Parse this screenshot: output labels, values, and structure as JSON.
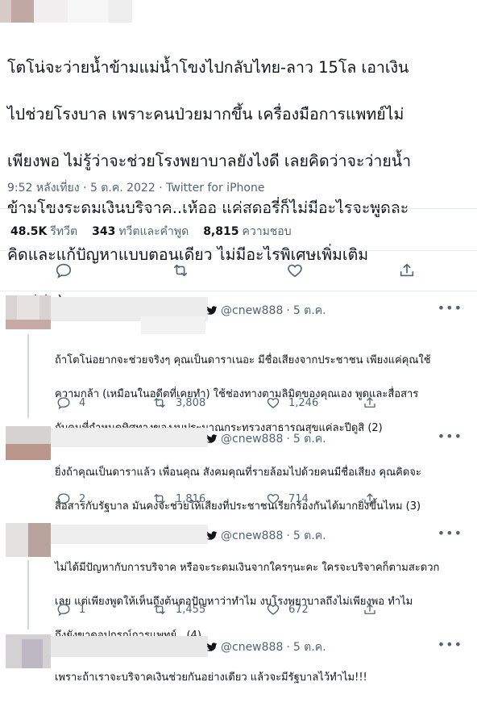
{
  "tweet": {
    "text": "โตโน่จะว่ายน้ำข้ามแม่น้ำโขงไปกลับไทย-ลาว 15โล เอาเงินไปช่วยโรงบาล เพราะคนป่วยมากขึ้น เครื่องมือการแพทย์ไม่เพียงพอ ไม่รู้ว่าจะช่วยโรงพยาบาลยังไงดี เลยคิดว่าจะว่ายน้ำข้ามโขงระดมเงินบริจาค..เห้ออ แค่สดอรี่ก็ไม่มีอะไรจะพูดละ คิดและแก้ปัญหาแบบตอนเดียว ไม่มีอะไรพิเศษเพิ่มเติมเลย(ต่อ)",
    "text_lines": [
      "โตโน่จะว่ายน้ำข้ามแม่น้ำโขงไปกลับไทย-ลาว 15โล เอาเงิน",
      "ไปช่วยโรงบาล เพราะคนป่วยมากขึ้น เครื่องมือการแพทย์ไม่",
      "เพียงพอ ไม่รู้ว่าจะช่วยโรงพยาบาลยังไงดี เลยคิดว่าจะว่ายน้ำ",
      "ข้ามโขงระดมเงินบริจาค..เห้ออ แค่สดอรี่ก็ไม่มีอะไรจะพูดละ",
      "คิดและแก้ปัญหาแบบตอนเดียว ไม่มีอะไรพิเศษเพิ่มเติม",
      "เลย(ต่อ)"
    ],
    "time": "9:52 หลังเที่ยง",
    "date": "5 ต.ค. 2022",
    "source": "Twitter for iPhone",
    "retweets_count": "48.5K",
    "retweets_label": "รีทวีต",
    "quotes_count": "343",
    "quotes_label": "ทวีตและคำพูด",
    "likes_count": "8,815",
    "likes_label": "ความชอบ"
  },
  "replies": [
    {
      "handle": "@cnew888",
      "date": "5 ต.ค.",
      "text_lines": [
        "ถ้าโตโน่อยากจะช่วยจริงๆ คุณเป็นดาราเนอะ มีชื่อเสียงจากประชาชน เพียงแค่คุณใช้",
        "ความกล้า (เหมือนในอดีตที่เคยทำ) ใช้ช่องทางตามลิมิตของคุณเอง พูดและสื่อสาร",
        "กับคนที่กำหนดทิศทางของงบประมาณกระทรวงสาธารณสุขแค่ละปีดูสิ (2)"
      ],
      "replies": "4",
      "retweets": "3,808",
      "likes": "1,246"
    },
    {
      "handle": "@cnew888",
      "date": "5 ต.ค.",
      "text_lines": [
        "ยิ่งถ้าคุณเป็นดาราแล้ว เพื่อนคุณ สังคมคุณที่รายล้อมไปด้วยคนมีชื่อเสียง คุณคิดจะ",
        "สื่อสารกับรัฐบาล มันคงจะช่วยให้เสียงที่ประชาชนเรียกร้องกันได้มากยิ่งขึ้นไหม (3)"
      ],
      "replies": "2",
      "retweets": "1,816",
      "likes": "714"
    },
    {
      "handle": "@cnew888",
      "date": "5 ต.ค.",
      "text_lines": [
        "ไม่ได้มีปัญหากับการบริจาค หรือจะระดมเงินจากใครๆนะคะ ใครจะบริจาคก็ตามสะดวก",
        "เลย แต่เพียงพูดให้เห็นถึงต้นตอปัญหาว่าทำไม งบโรงพยาบาลถึงไม่เพียงพอ ทำไม",
        "ถึงยังขาดอุปกรณ์การแพทย์.. (4)"
      ],
      "replies": "1",
      "retweets": "1,455",
      "likes": "672"
    },
    {
      "handle": "@cnew888",
      "date": "5 ต.ค.",
      "text_lines": [
        "เพราะถ้าเราจะบริจาคเงินช่วยกันอย่างเดียว แล้วจะมีรัฐบาลไว้ทำไม!!!"
      ]
    }
  ],
  "icons": {
    "reply": "speech-bubble-icon",
    "retweet": "retweet-icon",
    "like": "heart-icon",
    "share": "share-icon",
    "more": "more-dots-icon",
    "verified_bird": "twitter-bird-icon"
  },
  "colors": {
    "text": "#0f1419",
    "secondary": "#536471",
    "divider": "#e6ecf0"
  }
}
